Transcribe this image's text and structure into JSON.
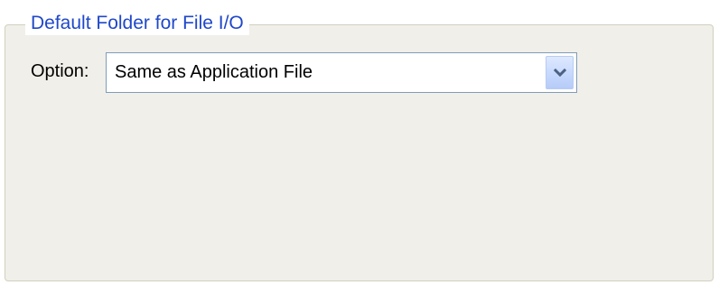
{
  "group": {
    "title": "Default Folder for File I/O"
  },
  "option": {
    "label": "Option:",
    "selected_value": "Same as Application File"
  },
  "icons": {
    "dropdown": "chevron-down-icon"
  },
  "colors": {
    "group_title": "#1f48c9",
    "panel_background": "#f1efe9",
    "combo_border": "#7f9db9"
  }
}
